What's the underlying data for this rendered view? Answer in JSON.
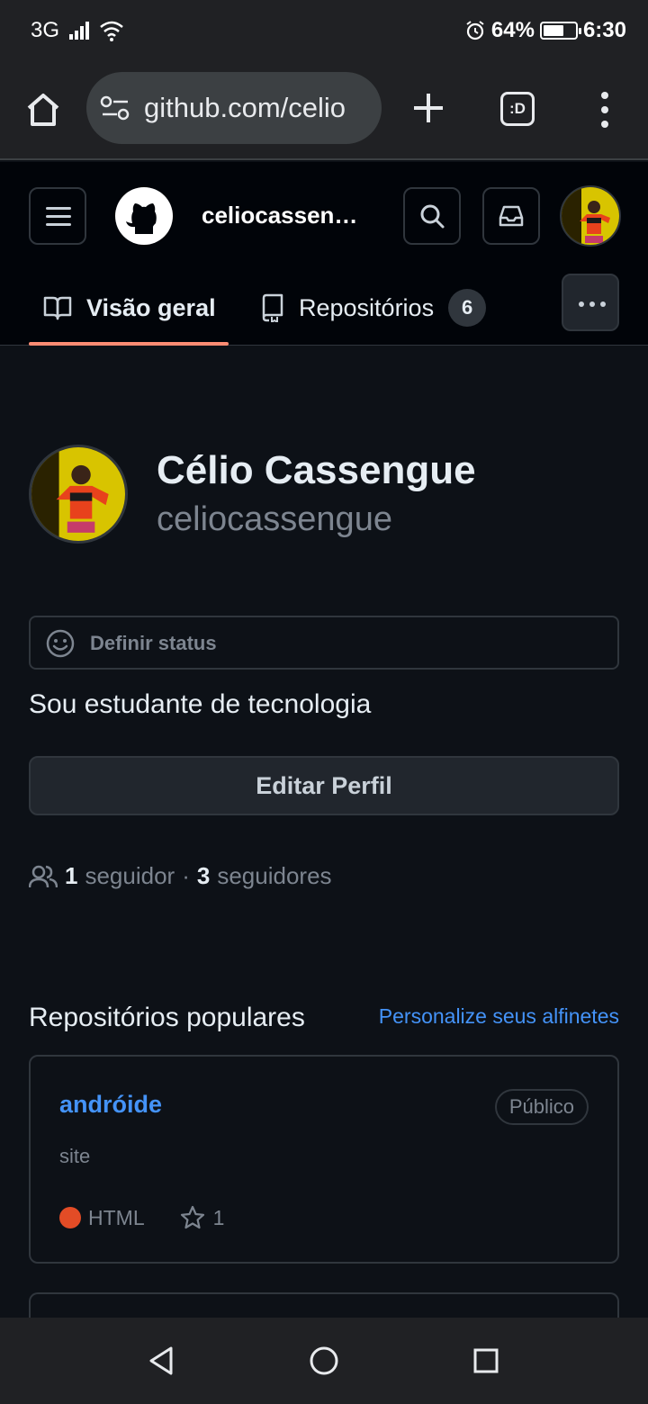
{
  "status_bar": {
    "network": "3G",
    "battery_percent": "64%",
    "battery_level": 0.64,
    "time": "6:30"
  },
  "browser": {
    "url": "github.com/celio"
  },
  "header": {
    "username": "celiocassen…",
    "tabs": [
      {
        "label": "Visão geral"
      },
      {
        "label": "Repositórios",
        "count": "6"
      }
    ]
  },
  "profile": {
    "full_name": "Célio Cassengue",
    "login": "celiocassengue",
    "status_label": "Definir status",
    "bio": "Sou estudante de tecnologia",
    "edit_label": "Editar Perfil",
    "followers_count": "1",
    "followers_label": "seguidor",
    "separator": "·",
    "following_count": "3",
    "following_label": "seguidores"
  },
  "pinned": {
    "heading": "Repositórios populares",
    "customize_link": "Personalize seus alfinetes",
    "repos": [
      {
        "name": "andróide",
        "visibility": "Público",
        "description": "site",
        "language": "HTML",
        "stars": "1"
      }
    ]
  },
  "colors": {
    "accent_link": "#4493f8",
    "tab_underline": "#fd8c73",
    "html_lang": "#e34c26"
  }
}
